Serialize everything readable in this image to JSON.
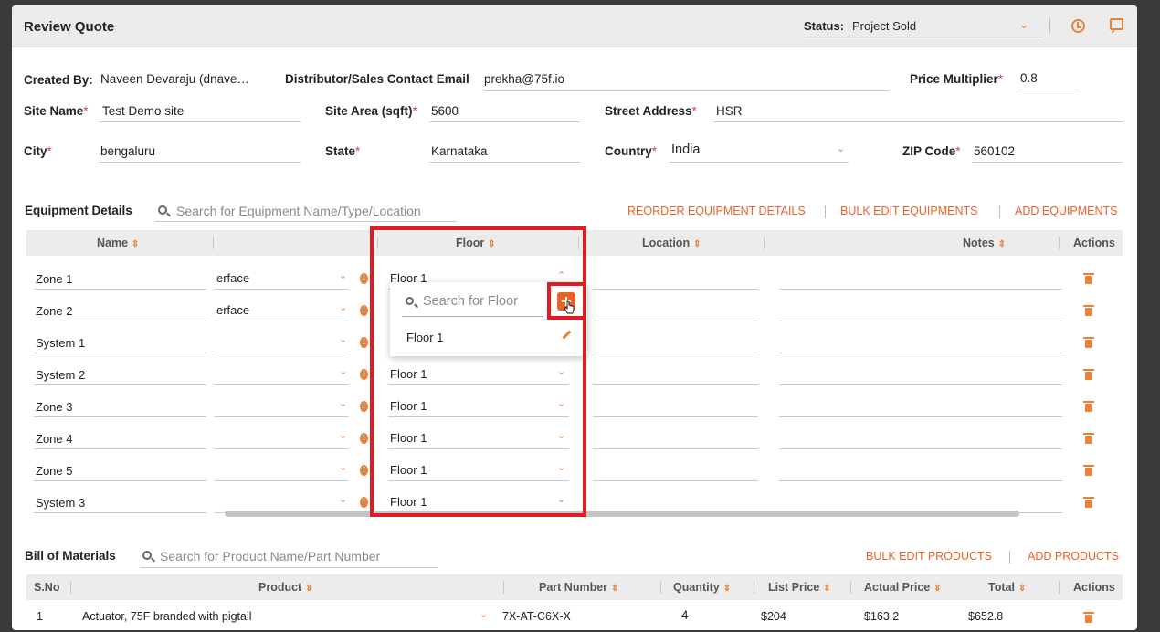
{
  "header": {
    "title": "Review Quote",
    "status_label": "Status:",
    "status_value": "Project Sold"
  },
  "form": {
    "created_by_label": "Created By:",
    "created_by_value": "Naveen Devaraju (dnave…",
    "distributor_label": "Distributor/Sales Contact Email",
    "distributor_value": "prekha@75f.io",
    "price_multiplier_label": "Price Multiplier",
    "price_multiplier_value": "0.8",
    "site_name_label": "Site Name",
    "site_name_value": "Test Demo site",
    "site_area_label": "Site Area (sqft)",
    "site_area_value": "5600",
    "street_label": "Street Address",
    "street_value": "HSR",
    "city_label": "City",
    "city_value": "bengaluru",
    "state_label": "State",
    "state_value": "Karnataka",
    "country_label": "Country",
    "country_value": "India",
    "zip_label": "ZIP Code",
    "zip_value": "560102",
    "required_mark": "*"
  },
  "equipment": {
    "title": "Equipment Details",
    "search_placeholder": "Search for Equipment Name/Type/Location",
    "reorder_label": "REORDER EQUIPMENT DETAILS",
    "bulk_edit_label": "BULK EDIT EQUIPMENTS",
    "add_label": "ADD EQUIPMENTS",
    "columns": {
      "name": "Name",
      "floor": "Floor",
      "location": "Location",
      "notes": "Notes",
      "actions": "Actions"
    },
    "rows": [
      {
        "name": "Zone 1",
        "type": "erface",
        "floor": "Floor 1"
      },
      {
        "name": "Zone 2",
        "type": "erface",
        "floor": ""
      },
      {
        "name": "System 1",
        "type": "",
        "floor": ""
      },
      {
        "name": "System 2",
        "type": "",
        "floor": "Floor 1"
      },
      {
        "name": "Zone 3",
        "type": "",
        "floor": "Floor 1"
      },
      {
        "name": "Zone 4",
        "type": "",
        "floor": "Floor 1"
      },
      {
        "name": "Zone 5",
        "type": "",
        "floor": "Floor 1"
      },
      {
        "name": "System 3",
        "type": "",
        "floor": "Floor 1"
      }
    ],
    "floor_dropdown": {
      "search_placeholder": "Search for Floor",
      "options": [
        "Floor 1"
      ]
    }
  },
  "bom": {
    "title": "Bill of Materials",
    "search_placeholder": "Search for Product Name/Part Number",
    "bulk_edit_label": "BULK EDIT PRODUCTS",
    "add_label": "ADD PRODUCTS",
    "columns": {
      "sno": "S.No",
      "product": "Product",
      "part": "Part Number",
      "qty": "Quantity",
      "list": "List Price",
      "actual": "Actual Price",
      "total": "Total",
      "actions": "Actions"
    },
    "rows": [
      {
        "sno": "1",
        "product": "Actuator, 75F branded with pigtail",
        "part": "7X-AT-C6X-X",
        "qty": "4",
        "list": "$204",
        "actual": "$163.2",
        "total": "$652.8"
      }
    ]
  },
  "colors": {
    "accent": "#e8632a",
    "highlight": "#e01b24"
  }
}
